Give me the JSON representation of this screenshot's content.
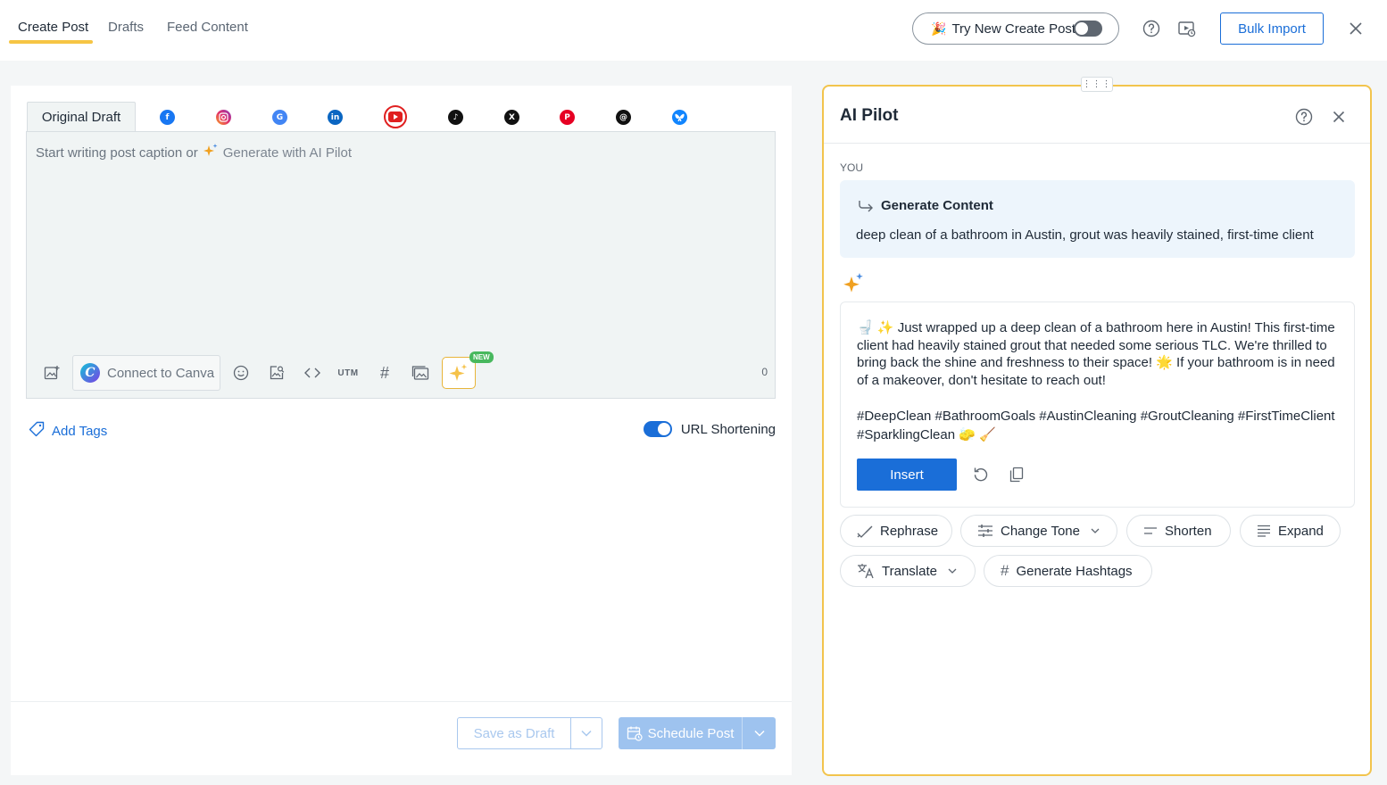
{
  "top_tabs": [
    {
      "label": "Create Post",
      "active": true
    },
    {
      "label": "Drafts",
      "active": false
    },
    {
      "label": "Feed Content",
      "active": false
    }
  ],
  "try_new": {
    "label": "Try New Create Post",
    "icon": "party-popper-icon",
    "toggled": false
  },
  "header_icons": [
    "help-icon",
    "video-guide-icon"
  ],
  "bulk_import_label": "Bulk Import",
  "editor": {
    "original_tab_label": "Original Draft",
    "networks": [
      "facebook",
      "instagram",
      "google",
      "linkedin",
      "youtube",
      "tiktok",
      "x",
      "pinterest",
      "threads",
      "bluesky"
    ],
    "placeholder_prefix": "Start writing post caption or",
    "placeholder_action": "Generate with AI Pilot",
    "canva_label": "Connect to Canva",
    "canva_logo": "C",
    "utm_label": "UTM",
    "new_badge": "NEW",
    "char_count": "0"
  },
  "add_tags_label": "Add Tags",
  "url_shortening": {
    "label": "URL Shortening",
    "enabled": true
  },
  "footer": {
    "save_draft_label": "Save as Draft",
    "schedule_label": "Schedule Post"
  },
  "ai_pilot": {
    "title": "AI Pilot",
    "you_label": "YOU",
    "prompt_title": "Generate Content",
    "prompt_text": "deep clean of a bathroom in Austin, grout was heavily stained, first-time client",
    "response_text": "🚽 ✨ Just wrapped up a deep clean of a bathroom here in Austin! This first-time client had heavily stained grout that needed some serious TLC. We're thrilled to bring back the shine and freshness to their space! 🌟 If your bathroom is in need of a makeover, don't hesitate to reach out!",
    "response_hashtags": "#DeepClean #BathroomGoals #AustinCleaning #GroutCleaning #FirstTimeClient #SparklingClean 🧽 🧹",
    "insert_label": "Insert",
    "actions": {
      "rephrase": "Rephrase",
      "change_tone": "Change Tone",
      "shorten": "Shorten",
      "expand": "Expand",
      "translate": "Translate",
      "generate_hashtags": "Generate Hashtags"
    }
  },
  "colors": {
    "accent": "#1a6ed8",
    "highlight": "#f6c544",
    "panel_border": "#f2c44d"
  }
}
